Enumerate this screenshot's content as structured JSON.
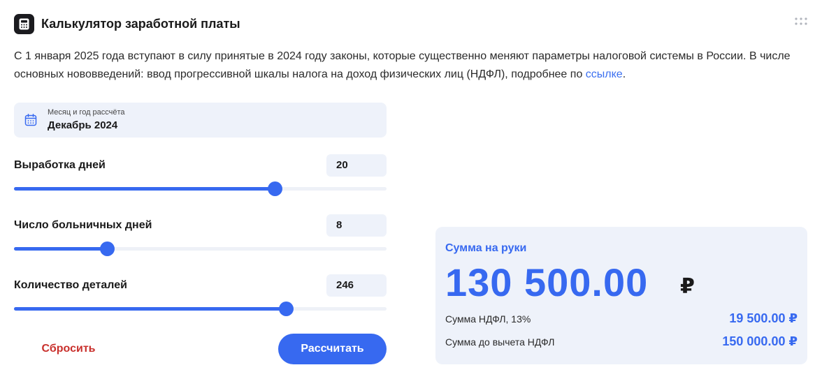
{
  "header": {
    "title": "Калькулятор заработной платы"
  },
  "intro": {
    "text": "С 1 января 2025 года вступают в силу принятые в 2024 году законы, которые существенно меняют параметры налоговой системы в России. В числе основных нововведений: ввод прогрессивной шкалы налога на доход физических лиц (НДФЛ), подробнее по ",
    "link_text": "ссылке",
    "end": "."
  },
  "date_picker": {
    "label": "Месяц и год рассчёта",
    "value": "Декабрь 2024"
  },
  "sliders": [
    {
      "label": "Выработка дней",
      "value": "20",
      "fill_fraction": 0.7
    },
    {
      "label": "Число больничных дней",
      "value": "8",
      "fill_fraction": 0.25
    },
    {
      "label": "Количество деталей",
      "value": "246",
      "fill_fraction": 0.73
    }
  ],
  "buttons": {
    "reset": "Сбросить",
    "calculate": "Рассчитать"
  },
  "result": {
    "label": "Сумма на руки",
    "amount": "130 500.00",
    "currency": "₽",
    "rows": [
      {
        "label": "Сумма НДФЛ, 13%",
        "value": "19 500.00 ₽"
      },
      {
        "label": "Сумма до вычета НДФЛ",
        "value": "150 000.00 ₽"
      }
    ]
  },
  "colors": {
    "accent": "#3769f0",
    "reset": "#c9302c",
    "panel": "#eef2fa"
  }
}
